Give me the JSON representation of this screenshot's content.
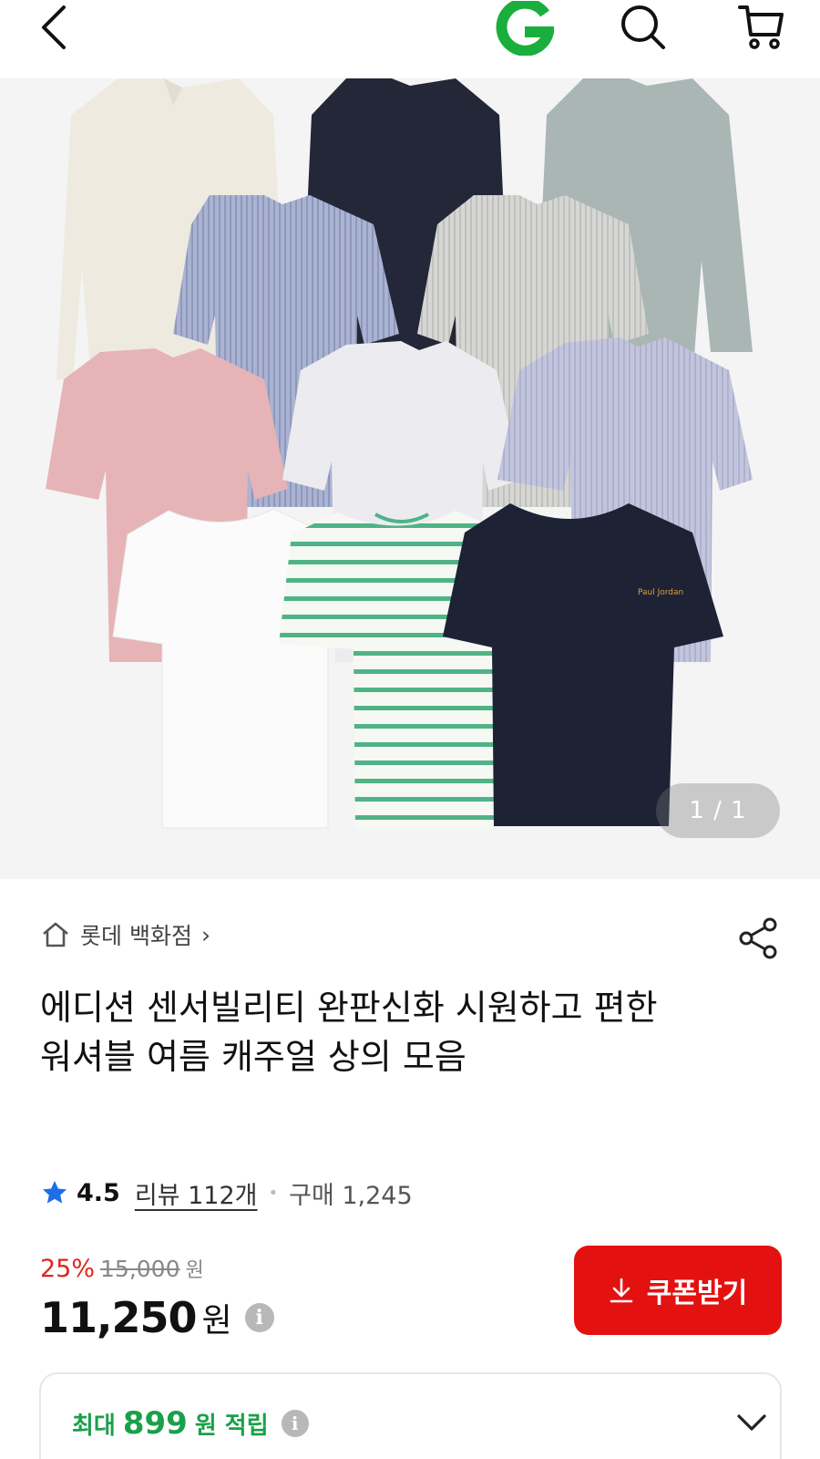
{
  "header": {
    "back_icon": "chevron-left-icon",
    "logo_letter": "G",
    "logo_color": "#1aae3c",
    "search_icon": "search-icon",
    "cart_icon": "cart-icon"
  },
  "gallery": {
    "counter": "1 / 1"
  },
  "product": {
    "seller": "롯데 백화점",
    "seller_chevron": "›",
    "title": "에디션 센서빌리티 완판신화 시원하고 편한 워셔블 여름 캐주얼 상의 모음",
    "rating": "4.5",
    "reviews": "리뷰 112개",
    "purchases": "구매 1,245",
    "discount_rate": "25%",
    "original_price": "15,000",
    "original_unit": "원",
    "price": "11,250",
    "price_unit": "원",
    "info_glyph": "i"
  },
  "coupon": {
    "label": "쿠폰받기",
    "color": "#e41111"
  },
  "points": {
    "prefix": "최대",
    "amount": "899",
    "suffix": "원 적립",
    "info_glyph": "i",
    "color": "#1aa04a"
  },
  "colors": {
    "accent_red": "#e0261b",
    "accent_green": "#1aa04a"
  }
}
